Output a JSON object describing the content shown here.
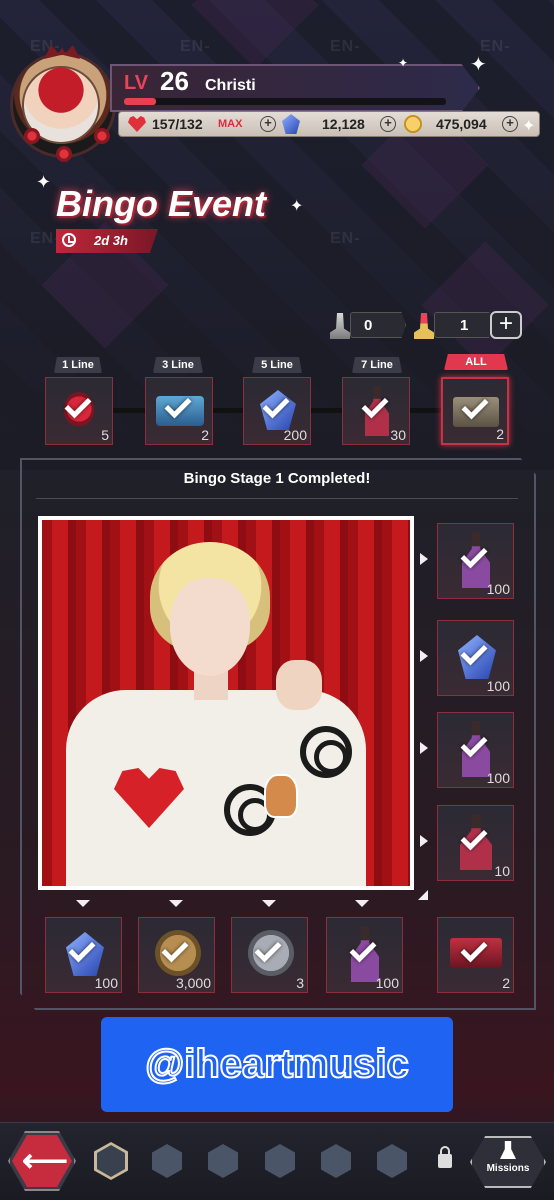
{
  "header": {
    "level_label": "LV",
    "level": "26",
    "player_name": "Christi",
    "xp_progress": 0.1,
    "energy": "157/132",
    "energy_max_label": "MAX",
    "gems": "12,128",
    "coins": "475,094"
  },
  "event": {
    "title": "Bingo Event",
    "timer": "2d 3h"
  },
  "tickets": {
    "silver_count": "0",
    "gold_count": "1"
  },
  "line_rewards": [
    {
      "label": "1 Line",
      "count": "5",
      "icon": "strawberry-item-icon",
      "claimed": true
    },
    {
      "label": "3 Line",
      "count": "2",
      "icon": "cassette-item-icon",
      "claimed": true
    },
    {
      "label": "5 Line",
      "count": "200",
      "icon": "blue-gem-icon",
      "claimed": true
    },
    {
      "label": "7 Line",
      "count": "30",
      "icon": "potion-bottle-icon",
      "claimed": true
    },
    {
      "label": "ALL",
      "count": "2",
      "icon": "ticket-card-icon",
      "claimed": true
    }
  ],
  "board": {
    "title": "Bingo Stage 1 Completed!",
    "side_rewards": [
      {
        "count": "100",
        "icon": "purple-potion-icon"
      },
      {
        "count": "100",
        "icon": "blue-gem-icon"
      },
      {
        "count": "100",
        "icon": "purple-potion-icon"
      },
      {
        "count": "10",
        "icon": "red-potion-icon"
      }
    ],
    "bottom_rewards": [
      {
        "count": "100",
        "icon": "blue-gem-icon"
      },
      {
        "count": "3,000",
        "icon": "gold-coin-icon"
      },
      {
        "count": "3",
        "icon": "silver-star-icon"
      },
      {
        "count": "100",
        "icon": "purple-potion-icon"
      },
      {
        "count": "2",
        "icon": "en-ticket-icon"
      }
    ]
  },
  "watermark": "@iheartmusic",
  "nav": {
    "missions_label": "Missions"
  },
  "colors": {
    "accent": "#e2384d",
    "watermark_bg": "#1f63f2",
    "background": "#1b1c25"
  }
}
